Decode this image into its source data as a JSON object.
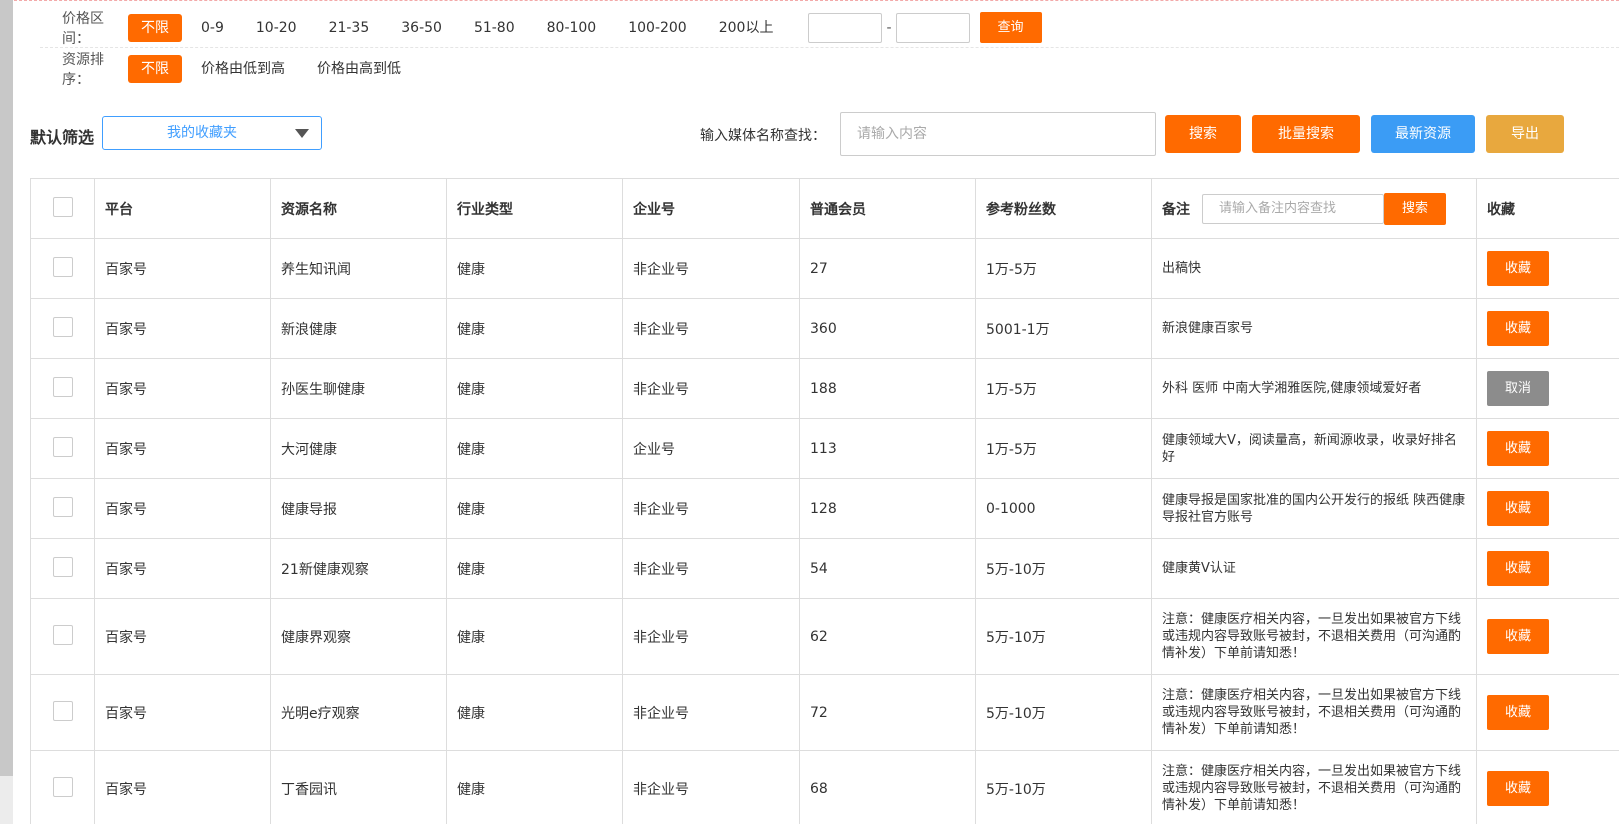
{
  "price_filter": {
    "label": "价格区间：",
    "options": [
      "不限",
      "0-9",
      "10-20",
      "21-35",
      "36-50",
      "51-80",
      "80-100",
      "100-200",
      "200以上"
    ],
    "active_index": 0,
    "range_separator": "-",
    "query_label": "查询"
  },
  "sort_filter": {
    "label": "资源排序：",
    "options": [
      "不限",
      "价格由低到高",
      "价格由高到低"
    ],
    "active_index": 0
  },
  "toolbar": {
    "default_filter_label": "默认筛选",
    "favorites_select": "我的收藏夹",
    "search_label": "输入媒体名称查找：",
    "search_placeholder": "请输入内容",
    "search_button": "搜索",
    "batch_search_button": "批量搜索",
    "new_resources_button": "最新资源",
    "export_button": "导出"
  },
  "colors": {
    "accent": "#ff6a00",
    "blue": "#3b9cf5",
    "export": "#e8a83e",
    "cancel": "#8c8c8c",
    "price": "#e0201f"
  },
  "table": {
    "headers": {
      "platform": "平台",
      "name": "资源名称",
      "industry": "行业类型",
      "enterprise": "企业号",
      "price": "普通会员",
      "fans": "参考粉丝数",
      "note": "备注",
      "note_placeholder": "请输入备注内容查找",
      "note_search": "搜索",
      "fav": "收藏"
    },
    "rows": [
      {
        "platform": "百家号",
        "name": "养生知讯闻",
        "industry": "健康",
        "enterprise": "非企业号",
        "price": "27",
        "fans": "1万-5万",
        "note": "出稿快",
        "action": "收藏"
      },
      {
        "platform": "百家号",
        "name": "新浪健康",
        "industry": "健康",
        "enterprise": "非企业号",
        "price": "360",
        "fans": "5001-1万",
        "note": "新浪健康百家号",
        "action": "收藏"
      },
      {
        "platform": "百家号",
        "name": "孙医生聊健康",
        "industry": "健康",
        "enterprise": "非企业号",
        "price": "188",
        "fans": "1万-5万",
        "note": "外科 医师 中南大学湘雅医院,健康领域爱好者",
        "action": "取消"
      },
      {
        "platform": "百家号",
        "name": "大河健康",
        "industry": "健康",
        "enterprise": "企业号",
        "price": "113",
        "fans": "1万-5万",
        "note": "健康领域大V，阅读量高，新闻源收录，收录好排名好",
        "action": "收藏"
      },
      {
        "platform": "百家号",
        "name": "健康导报",
        "industry": "健康",
        "enterprise": "非企业号",
        "price": "128",
        "fans": "0-1000",
        "note": "健康导报是国家批准的国内公开发行的报纸 陕西健康导报社官方账号",
        "action": "收藏"
      },
      {
        "platform": "百家号",
        "name": "21新健康观察",
        "industry": "健康",
        "enterprise": "非企业号",
        "price": "54",
        "fans": "5万-10万",
        "note": "健康黄V认证",
        "action": "收藏"
      },
      {
        "platform": "百家号",
        "name": "健康界观察",
        "industry": "健康",
        "enterprise": "非企业号",
        "price": "62",
        "fans": "5万-10万",
        "note": "注意：健康医疗相关内容，一旦发出如果被官方下线或违规内容导致账号被封，不退相关费用（可沟通酌情补发）下单前请知悉！",
        "action": "收藏"
      },
      {
        "platform": "百家号",
        "name": "光明e疗观察",
        "industry": "健康",
        "enterprise": "非企业号",
        "price": "72",
        "fans": "5万-10万",
        "note": "注意：健康医疗相关内容，一旦发出如果被官方下线或违规内容导致账号被封，不退相关费用（可沟通酌情补发）下单前请知悉！",
        "action": "收藏"
      },
      {
        "platform": "百家号",
        "name": "丁香园讯",
        "industry": "健康",
        "enterprise": "非企业号",
        "price": "68",
        "fans": "5万-10万",
        "note": "注意：健康医疗相关内容，一旦发出如果被官方下线或违规内容导致账号被封，不退相关费用（可沟通酌情补发）下单前请知悉！",
        "action": "收藏"
      }
    ]
  }
}
